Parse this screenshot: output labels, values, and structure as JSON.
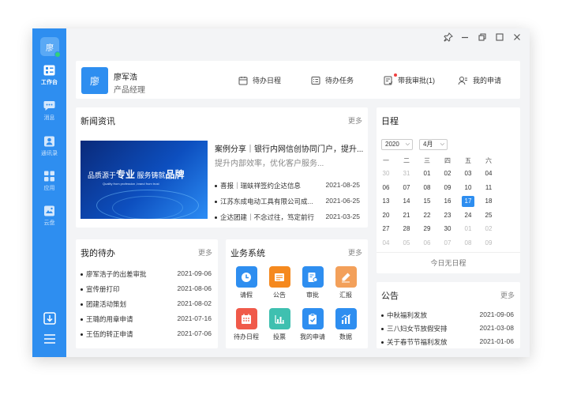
{
  "app": {
    "avatar_text": "廖",
    "nav": [
      {
        "label": "工作台",
        "icon": "dashboard-icon",
        "active": true
      },
      {
        "label": "消息",
        "icon": "chat-icon",
        "active": false
      },
      {
        "label": "通讯录",
        "icon": "contacts-icon",
        "active": false
      },
      {
        "label": "应用",
        "icon": "apps-icon",
        "active": false
      },
      {
        "label": "云盘",
        "icon": "cloud-drive-icon",
        "active": false
      }
    ]
  },
  "titlebar": {
    "icons": [
      "pin-icon",
      "minimize-icon",
      "restore-icon",
      "maximize-icon",
      "close-icon"
    ]
  },
  "profile": {
    "avatar_text": "廖",
    "name": "廖军浩",
    "title": "产品经理",
    "quick_links": [
      {
        "label": "待办日程",
        "icon": "schedule-icon"
      },
      {
        "label": "待办任务",
        "icon": "task-icon"
      },
      {
        "label": "带我审批(1)",
        "icon": "approval-icon",
        "badge": true
      },
      {
        "label": "我的申请",
        "icon": "application-icon"
      }
    ]
  },
  "news": {
    "title": "新闻资讯",
    "more": "更多",
    "banner": {
      "prefix1": "品质源于",
      "em1": "专业",
      "prefix2": " 服务铸就",
      "em2": "品牌",
      "subtitle": "Quality from profession ,brand from trust"
    },
    "headline": "案例分享｜银行内网信创协同门户，提升...",
    "summary": "提升内部效率，优化客户服务...",
    "items": [
      {
        "text": "喜报｜瑞蚨祥签约企达信息",
        "date": "2021-08-25"
      },
      {
        "text": "江苏东成电动工具有限公司成...",
        "date": "2021-06-25"
      },
      {
        "text": "企达团建｜不念过往，笃定前行",
        "date": "2021-03-25"
      }
    ]
  },
  "todo": {
    "title": "我的待办",
    "more": "更多",
    "items": [
      {
        "text": "廖军浩子的出差审批",
        "date": "2021-09-06"
      },
      {
        "text": "宣传册打印",
        "date": "2021-08-06"
      },
      {
        "text": "团建活动策划",
        "date": "2021-08-02"
      },
      {
        "text": "王璐的用章申请",
        "date": "2021-07-16"
      },
      {
        "text": "王伍的转正申请",
        "date": "2021-07-06"
      }
    ]
  },
  "business": {
    "title": "业务系统",
    "more": "更多",
    "apps": [
      {
        "label": "请假",
        "icon": "clock-icon",
        "color": "#2e8ef0"
      },
      {
        "label": "公告",
        "icon": "announcement-icon",
        "color": "#f5891f"
      },
      {
        "label": "审批",
        "icon": "approval-doc-icon",
        "color": "#2e8ef0"
      },
      {
        "label": "汇报",
        "icon": "pen-icon",
        "color": "#f3a05a"
      },
      {
        "label": "待办日程",
        "icon": "calendar-icon",
        "color": "#f05a4a"
      },
      {
        "label": "投票",
        "icon": "bar-chart-icon",
        "color": "#3fc0b0"
      },
      {
        "label": "我的申请",
        "icon": "clipboard-check-icon",
        "color": "#2e8ef0"
      },
      {
        "label": "数据",
        "icon": "data-chart-icon",
        "color": "#2e8ef0"
      }
    ]
  },
  "calendar": {
    "title": "日程",
    "year": "2020",
    "month": "4月",
    "weekdays": [
      "一",
      "二",
      "三",
      "四",
      "五",
      "六"
    ],
    "weeks": [
      [
        {
          "d": "30",
          "dim": true
        },
        {
          "d": "31",
          "dim": true
        },
        {
          "d": "01"
        },
        {
          "d": "02"
        },
        {
          "d": "03"
        },
        {
          "d": "04"
        }
      ],
      [
        {
          "d": "06"
        },
        {
          "d": "07"
        },
        {
          "d": "08"
        },
        {
          "d": "09"
        },
        {
          "d": "10"
        },
        {
          "d": "11"
        }
      ],
      [
        {
          "d": "13"
        },
        {
          "d": "14"
        },
        {
          "d": "15"
        },
        {
          "d": "16"
        },
        {
          "d": "17",
          "today": true
        },
        {
          "d": "18"
        }
      ],
      [
        {
          "d": "20"
        },
        {
          "d": "21"
        },
        {
          "d": "22"
        },
        {
          "d": "23"
        },
        {
          "d": "24"
        },
        {
          "d": "25"
        }
      ],
      [
        {
          "d": "27"
        },
        {
          "d": "28"
        },
        {
          "d": "29"
        },
        {
          "d": "30"
        },
        {
          "d": "01",
          "dim": true
        },
        {
          "d": "02",
          "dim": true
        }
      ],
      [
        {
          "d": "04",
          "dim": true
        },
        {
          "d": "05",
          "dim": true
        },
        {
          "d": "06",
          "dim": true
        },
        {
          "d": "07",
          "dim": true
        },
        {
          "d": "08",
          "dim": true
        },
        {
          "d": "09",
          "dim": true
        }
      ]
    ],
    "empty_text": "今日无日程"
  },
  "notice": {
    "title": "公告",
    "more": "更多",
    "items": [
      {
        "text": "中秋福利发放",
        "date": "2021-09-06"
      },
      {
        "text": "三八妇女节放假安排",
        "date": "2021-03-08"
      },
      {
        "text": "关于春节节福利发放",
        "date": "2021-01-06"
      }
    ]
  }
}
